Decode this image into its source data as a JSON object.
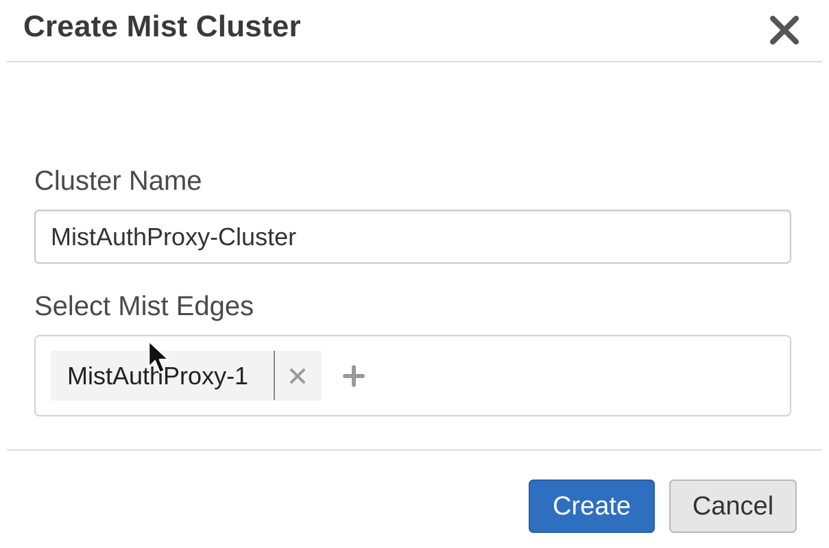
{
  "dialog": {
    "title": "Create Mist Cluster",
    "close_icon": "close-icon"
  },
  "form": {
    "cluster_name": {
      "label": "Cluster Name",
      "value": "MistAuthProxy-Cluster"
    },
    "mist_edges": {
      "label": "Select Mist Edges",
      "selected": [
        {
          "label": "MistAuthProxy-1",
          "remove_icon": "close-icon"
        }
      ],
      "add_icon": "plus-icon"
    }
  },
  "footer": {
    "create_label": "Create",
    "cancel_label": "Cancel"
  },
  "colors": {
    "primary": "#2f6fc0",
    "secondary_button": "#e6e6e6",
    "divider": "#dcdcdc"
  }
}
